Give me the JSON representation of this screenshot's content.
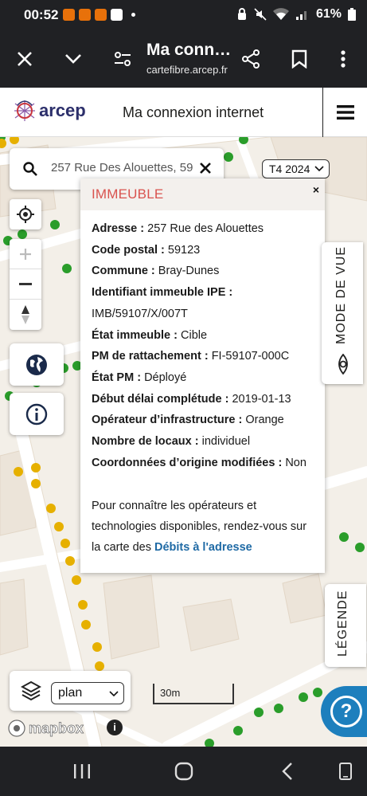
{
  "status": {
    "time": "00:52",
    "battery": "61%"
  },
  "browser": {
    "title": "Ma conn…",
    "url": "cartefibre.arcep.fr"
  },
  "site": {
    "logo": "arcep",
    "title": "Ma connexion internet"
  },
  "search": {
    "value": "257 Rue Des Alouettes, 59"
  },
  "period": {
    "selected": "T4 2024"
  },
  "popup": {
    "title": "IMMEUBLE",
    "close": "×",
    "rows": [
      {
        "label": "Adresse :",
        "value": "257 Rue des Alouettes"
      },
      {
        "label": "Code postal :",
        "value": "59123"
      },
      {
        "label": "Commune :",
        "value": "Bray-Dunes"
      },
      {
        "label": "Identifiant immeuble IPE :",
        "value": ""
      },
      {
        "label": "",
        "value": "IMB/59107/X/007T"
      },
      {
        "label": "État immeuble :",
        "value": "Cible"
      },
      {
        "label": "PM de rattachement :",
        "value": "FI-59107-000C"
      },
      {
        "label": "État PM :",
        "value": "Déployé"
      },
      {
        "label": "Début délai complétude :",
        "value": "2019-01-13"
      },
      {
        "label": "Opérateur d’infrastructure :",
        "value": "Orange"
      },
      {
        "label": "Nombre de locaux :",
        "value": "individuel"
      },
      {
        "label": "Coordonnées d’origine modifiées :",
        "value": "Non"
      }
    ],
    "footer_text": "Pour connaître les opérateurs et technologies disponibles, rendez-vous sur la carte des ",
    "footer_link": "Débits à l'adresse"
  },
  "side_tabs": {
    "view_mode": "MODE DE VUE",
    "legend": "LÉGENDE"
  },
  "layers": {
    "selected": "plan"
  },
  "scale": {
    "label": "30m"
  },
  "help": {
    "label": "?"
  },
  "attribution": {
    "mapbox": "mapbox",
    "info": "i"
  },
  "colors": {
    "green_dot": "#2a9d2a",
    "yellow_dot": "#e6b000",
    "accent_blue": "#1d7fbd",
    "popup_title": "#d9534f"
  },
  "icons": [
    "close-icon",
    "chevron-down-icon",
    "tune-icon",
    "share-icon",
    "bookmark-icon",
    "more-vert-icon",
    "hamburger-icon",
    "search-icon",
    "clear-icon",
    "locate-icon",
    "zoom-in-icon",
    "zoom-out-icon",
    "compass-icon",
    "globe-icon",
    "info-icon",
    "layers-icon",
    "eye-icon"
  ]
}
